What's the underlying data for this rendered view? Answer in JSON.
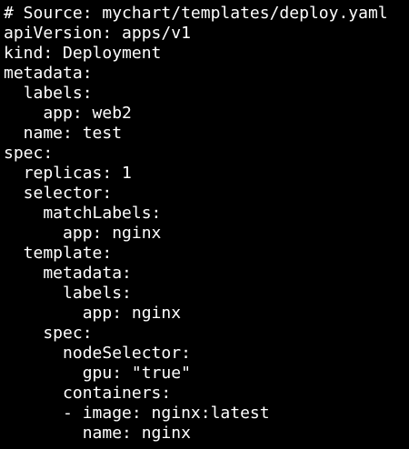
{
  "terminal": {
    "background_color": "#000000",
    "text_color": "#ffffff",
    "lines": [
      "# Source: mychart/templates/deploy.yaml",
      "apiVersion: apps/v1",
      "kind: Deployment",
      "metadata:",
      "  labels:",
      "    app: web2",
      "  name: test",
      "spec:",
      "  replicas: 1",
      "  selector:",
      "    matchLabels:",
      "      app: nginx",
      "  template:",
      "    metadata:",
      "      labels:",
      "        app: nginx",
      "    spec:",
      "      nodeSelector:",
      "        gpu: \"true\"",
      "      containers:",
      "      - image: nginx:latest",
      "        name: nginx"
    ]
  }
}
